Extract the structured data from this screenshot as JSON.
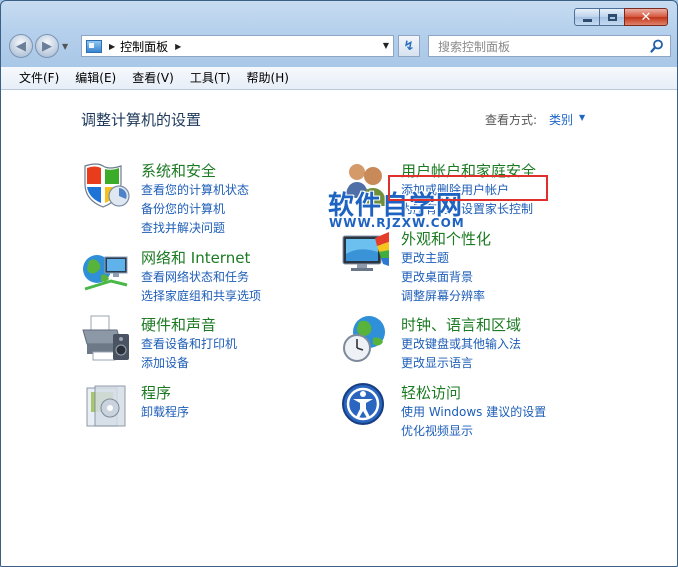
{
  "window": {
    "search_placeholder": "搜索控制面板",
    "address": {
      "segments": [
        "控制面板"
      ]
    }
  },
  "menu": [
    "文件(F)",
    "编辑(E)",
    "查看(V)",
    "工具(T)",
    "帮助(H)"
  ],
  "page": {
    "title": "调整计算机的设置",
    "view_by_label": "查看方式:",
    "view_by_value": "类别"
  },
  "categories": [
    {
      "title": "系统和安全",
      "icon": "shield-icon",
      "links": [
        "查看您的计算机状态",
        "备份您的计算机",
        "查找并解决问题"
      ]
    },
    {
      "title": "网络和 Internet",
      "icon": "network-icon",
      "links": [
        "查看网络状态和任务",
        "选择家庭组和共享选项"
      ]
    },
    {
      "title": "硬件和声音",
      "icon": "printer-icon",
      "links": [
        "查看设备和打印机",
        "添加设备"
      ]
    },
    {
      "title": "程序",
      "icon": "programs-icon",
      "links": [
        "卸载程序"
      ]
    },
    {
      "title": "用户帐户和家庭安全",
      "icon": "users-icon",
      "links": [
        "添加或删除用户帐户",
        "为所有用户设置家长控制"
      ]
    },
    {
      "title": "外观和个性化",
      "icon": "monitor-icon",
      "links": [
        "更改主题",
        "更改桌面背景",
        "调整屏幕分辨率"
      ]
    },
    {
      "title": "时钟、语言和区域",
      "icon": "globe-clock-icon",
      "links": [
        "更改键盘或其他输入法",
        "更改显示语言"
      ]
    },
    {
      "title": "轻松访问",
      "icon": "accessibility-icon",
      "links": [
        "使用 Windows 建议的设置",
        "优化视频显示"
      ]
    }
  ],
  "watermark": {
    "title": "软件自学网",
    "url": "WWW.RJZXW.COM"
  },
  "colors": {
    "link": "#1e5eb8",
    "category_title": "#1c7a23",
    "highlight": "#e0302c"
  }
}
